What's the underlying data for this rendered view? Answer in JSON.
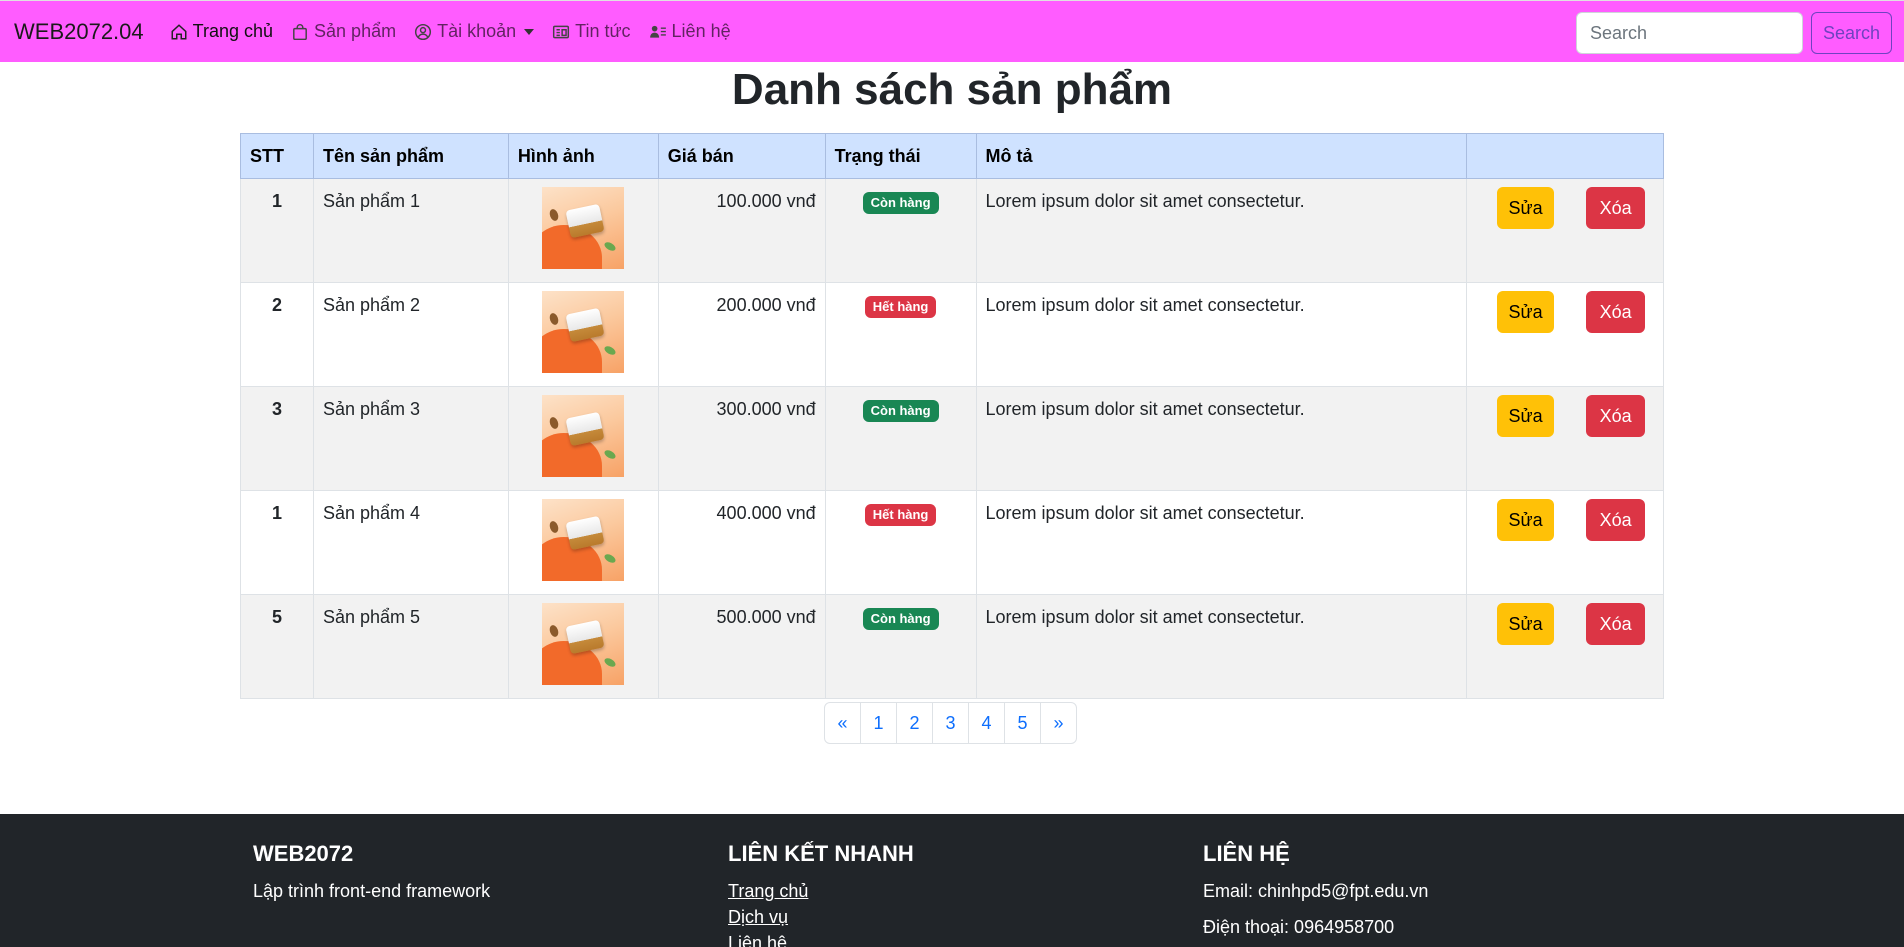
{
  "navbar": {
    "brand": "WEB2072.04",
    "items": [
      {
        "label": "Trang chủ",
        "icon": "house-icon"
      },
      {
        "label": "Sản phẩm",
        "icon": "bag-icon"
      },
      {
        "label": "Tài khoản",
        "icon": "person-circle-icon"
      },
      {
        "label": "Tin tức",
        "icon": "newspaper-icon"
      },
      {
        "label": "Liên hệ",
        "icon": "person-lines-icon"
      }
    ],
    "search_placeholder": "Search",
    "search_button": "Search"
  },
  "page": {
    "title": "Danh sách sản phẩm"
  },
  "table": {
    "headers": [
      "STT",
      "Tên sản phẩm",
      "Hình ảnh",
      "Giá bán",
      "Trạng thái",
      "Mô tả",
      ""
    ],
    "edit_label": "Sửa",
    "delete_label": "Xóa",
    "rows": [
      {
        "stt": "1",
        "name": "Sản phẩm 1",
        "price": "100.000 vnđ",
        "status": "Còn hàng",
        "status_type": "in-stock",
        "desc": "Lorem ipsum dolor sit amet consectetur."
      },
      {
        "stt": "2",
        "name": "Sản phẩm 2",
        "price": "200.000 vnđ",
        "status": "Hết hàng",
        "status_type": "out-of-stock",
        "desc": "Lorem ipsum dolor sit amet consectetur."
      },
      {
        "stt": "3",
        "name": "Sản phẩm 3",
        "price": "300.000 vnđ",
        "status": "Còn hàng",
        "status_type": "in-stock",
        "desc": "Lorem ipsum dolor sit amet consectetur."
      },
      {
        "stt": "1",
        "name": "Sản phẩm 4",
        "price": "400.000 vnđ",
        "status": "Hết hàng",
        "status_type": "out-of-stock",
        "desc": "Lorem ipsum dolor sit amet consectetur."
      },
      {
        "stt": "5",
        "name": "Sản phẩm 5",
        "price": "500.000 vnđ",
        "status": "Còn hàng",
        "status_type": "in-stock",
        "desc": "Lorem ipsum dolor sit amet consectetur."
      }
    ]
  },
  "pagination": {
    "prev": "«",
    "pages": [
      "1",
      "2",
      "3",
      "4",
      "5"
    ],
    "next": "»"
  },
  "footer": {
    "about": {
      "title": "WEB2072",
      "text": "Lập trình front-end framework"
    },
    "links": {
      "title": "LIÊN KẾT NHANH",
      "items": [
        "Trang chủ",
        "Dịch vụ",
        "Liên hệ"
      ]
    },
    "contact": {
      "title": "LIÊN HỆ",
      "email": "Email: chinhpd5@fpt.edu.vn",
      "phone": "Điện thoại: 0964958700"
    }
  },
  "colors": {
    "navbar_bg": "#ff5cff",
    "table_header_bg": "#cfe2ff",
    "badge_in_stock": "#198754",
    "badge_out_of_stock": "#dc3545",
    "edit_button": "#ffc107",
    "delete_button": "#dc3545",
    "footer_bg": "#212529"
  }
}
